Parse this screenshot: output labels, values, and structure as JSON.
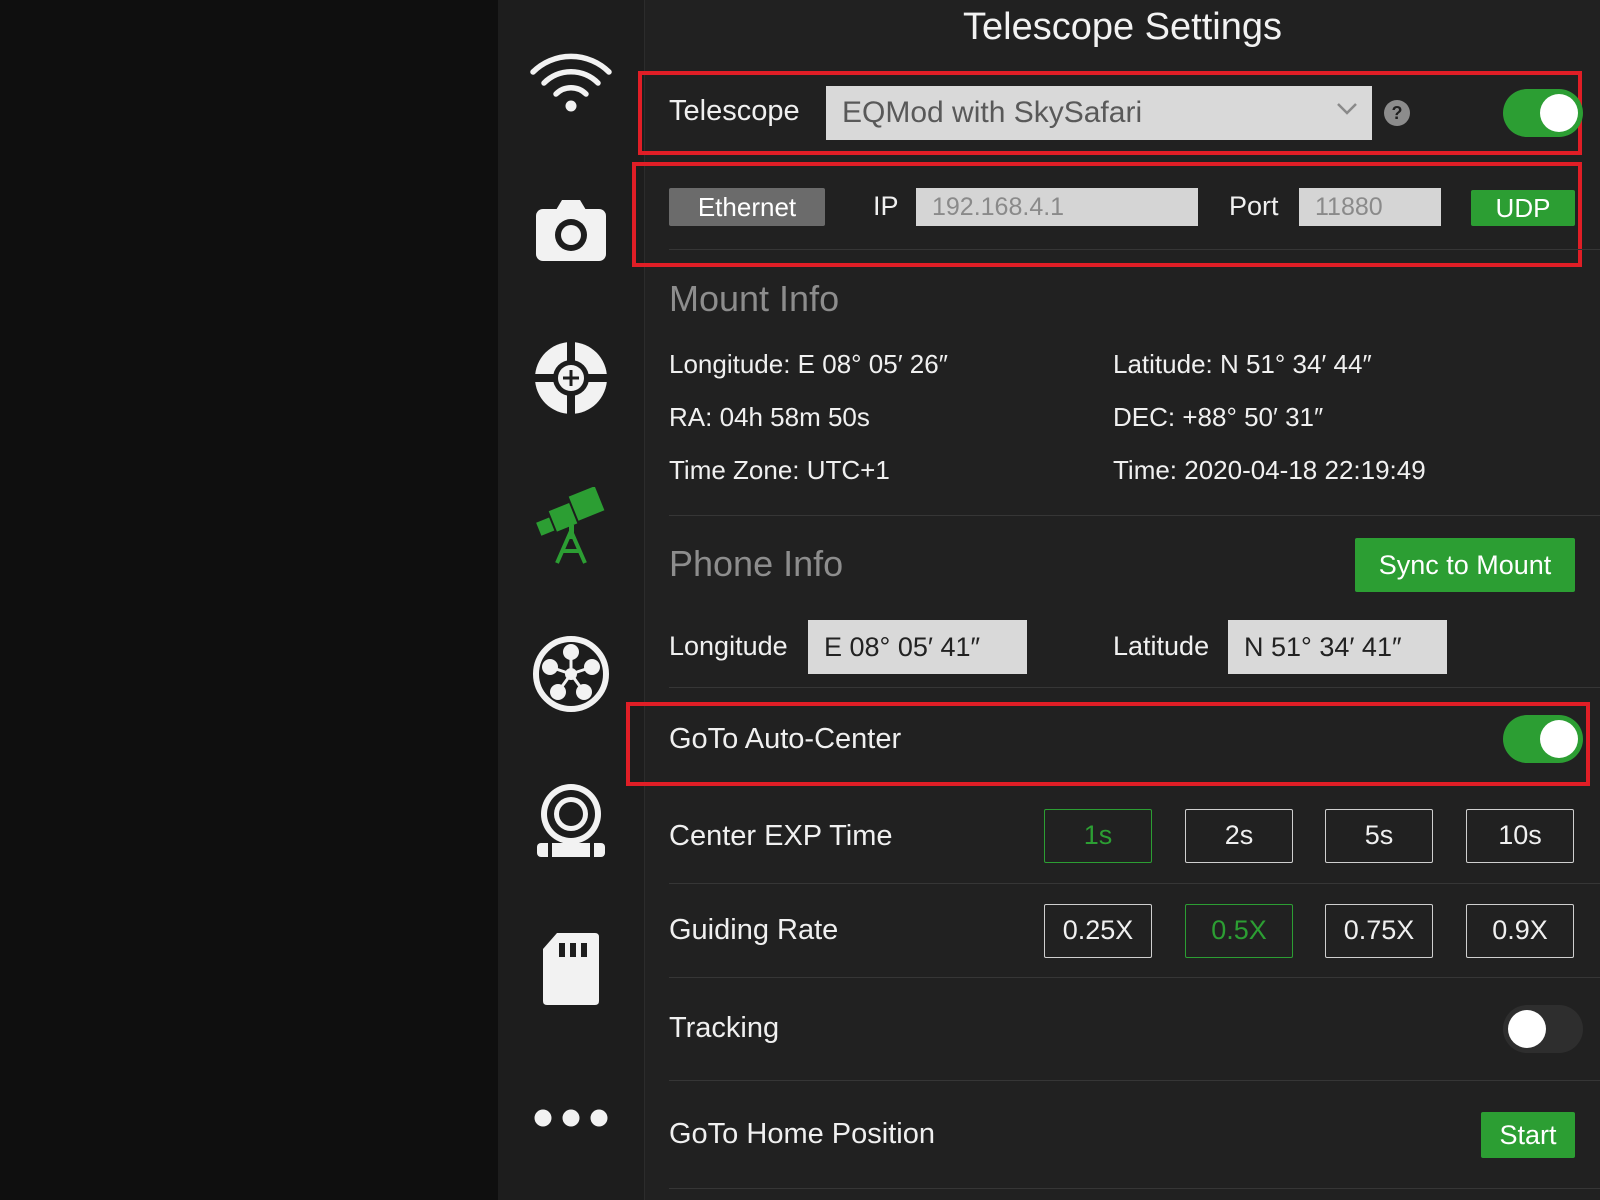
{
  "page_title": "Telescope Settings",
  "sidebar": {
    "items": [
      {
        "icon": "wifi-icon"
      },
      {
        "icon": "camera-icon"
      },
      {
        "icon": "crosshair-icon"
      },
      {
        "icon": "telescope-icon",
        "active": true
      },
      {
        "icon": "filter-wheel-icon"
      },
      {
        "icon": "focuser-icon"
      },
      {
        "icon": "sd-card-icon"
      },
      {
        "icon": "more-icon"
      }
    ]
  },
  "telescope": {
    "label": "Telescope",
    "selected": "EQMod with SkySafari",
    "help": "?",
    "enabled": true
  },
  "connection": {
    "type_label": "Ethernet",
    "ip_label": "IP",
    "ip_placeholder": "192.168.4.1",
    "port_label": "Port",
    "port_placeholder": "11880",
    "protocol_label": "UDP"
  },
  "mount_info": {
    "title": "Mount Info",
    "longitude": "Longitude: E 08° 05′ 26″",
    "latitude": "Latitude: N 51° 34′ 44″",
    "ra": "RA: 04h 58m 50s",
    "dec": "DEC: +88° 50′ 31″",
    "timezone": "Time Zone: UTC+1",
    "time": "Time: 2020-04-18 22:19:49"
  },
  "phone_info": {
    "title": "Phone Info",
    "sync_label": "Sync to Mount",
    "longitude_label": "Longitude",
    "longitude_value": "E 08° 05′ 41″",
    "latitude_label": "Latitude",
    "latitude_value": "N 51° 34′ 41″"
  },
  "goto_auto_center": {
    "label": "GoTo Auto-Center",
    "enabled": true
  },
  "center_exp": {
    "label": "Center EXP Time",
    "options": [
      "1s",
      "2s",
      "5s",
      "10s"
    ],
    "selected": "1s"
  },
  "guiding_rate": {
    "label": "Guiding Rate",
    "options": [
      "0.25X",
      "0.5X",
      "0.75X",
      "0.9X"
    ],
    "selected": "0.5X"
  },
  "tracking": {
    "label": "Tracking",
    "enabled": false
  },
  "goto_home": {
    "label": "GoTo Home Position",
    "button_label": "Start"
  },
  "colors": {
    "accent_green": "#2c9e33",
    "highlight_red": "#e01e26",
    "background": "#212121"
  }
}
